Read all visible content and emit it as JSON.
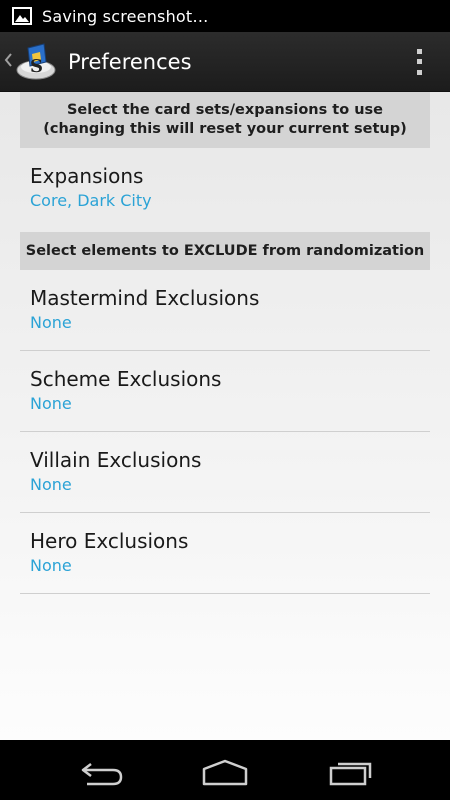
{
  "status_bar": {
    "notification_icon": "image-icon",
    "text": "Saving screenshot…"
  },
  "action_bar": {
    "title": "Preferences",
    "up_icon": "chevron-left-icon",
    "logo": "app-logo",
    "overflow_icon": "overflow-menu-icon"
  },
  "sections": [
    {
      "header_line1": "Select the card sets/expansions to use",
      "header_line2": "(changing this will reset your current setup)",
      "items": [
        {
          "title": "Expansions",
          "summary": "Core, Dark City"
        }
      ]
    },
    {
      "header": "Select elements to EXCLUDE from randomization",
      "items": [
        {
          "title": "Mastermind Exclusions",
          "summary": "None"
        },
        {
          "title": "Scheme Exclusions",
          "summary": "None"
        },
        {
          "title": "Villain Exclusions",
          "summary": "None"
        },
        {
          "title": "Hero Exclusions",
          "summary": "None"
        }
      ]
    }
  ],
  "nav_bar": {
    "back_icon": "back-icon",
    "home_icon": "home-icon",
    "recents_icon": "recent-apps-icon"
  },
  "colors": {
    "summary": "#2ba3d6",
    "category_bg": "#d4d4d4",
    "action_bar_bg": "#222222"
  }
}
